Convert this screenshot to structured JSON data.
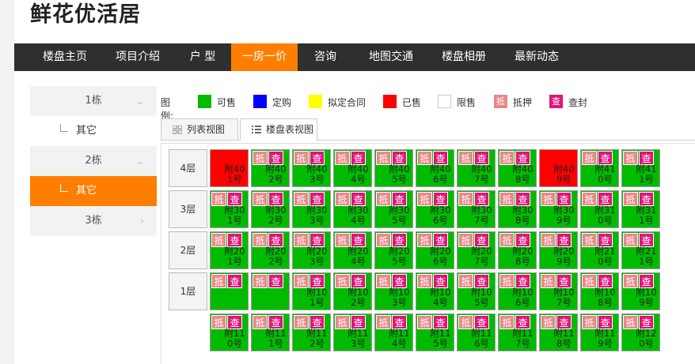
{
  "site": {
    "title": "鲜花优活居"
  },
  "nav": {
    "items": [
      "楼盘主页",
      "项目介绍",
      "户 型",
      "一房一价",
      "咨询",
      "地图交通",
      "楼盘相册",
      "最新动态"
    ],
    "active": "一房一价"
  },
  "sidebar": {
    "buildings": [
      {
        "label": "1栋",
        "arrow": "⌄",
        "sub": "其它",
        "sub_active": false
      },
      {
        "label": "2栋",
        "arrow": "⌄",
        "sub": "其它",
        "sub_active": true
      },
      {
        "label": "3栋",
        "arrow": "›"
      }
    ]
  },
  "legend": {
    "title": "图例:",
    "items": [
      {
        "label": "可售",
        "color": "#00bb00"
      },
      {
        "label": "定购",
        "color": "#0000ff"
      },
      {
        "label": "拟定合同",
        "color": "#ffff00"
      },
      {
        "label": "已售",
        "color": "#ff0000"
      },
      {
        "label": "限售",
        "color": "#ffffff"
      },
      {
        "label": "抵押",
        "badge": "抵",
        "color": "#e8888a"
      },
      {
        "label": "查封",
        "badge": "查",
        "color": "#e0147a"
      }
    ]
  },
  "tabs": {
    "list_view": "列表视图",
    "table_view": "楼盘表视图",
    "active": "楼盘表视图"
  },
  "badges": {
    "mortgage": "抵",
    "seized": "查"
  },
  "floors": [
    {
      "label": "4层",
      "units": [
        {
          "name": "附401号",
          "status": "sold",
          "badges": false
        },
        {
          "name": "附402号",
          "status": "avail",
          "badges": true
        },
        {
          "name": "附403号",
          "status": "avail",
          "badges": true
        },
        {
          "name": "附404号",
          "status": "avail",
          "badges": true
        },
        {
          "name": "附405号",
          "status": "avail",
          "badges": true
        },
        {
          "name": "附406号",
          "status": "avail",
          "badges": true
        },
        {
          "name": "附407号",
          "status": "avail",
          "badges": true
        },
        {
          "name": "附408号",
          "status": "avail",
          "badges": true
        },
        {
          "name": "附409号",
          "status": "sold",
          "badges": false
        },
        {
          "name": "附410号",
          "status": "avail",
          "badges": true
        },
        {
          "name": "附411号",
          "status": "avail",
          "badges": true
        }
      ]
    },
    {
      "label": "3层",
      "units": [
        {
          "name": "附301号",
          "status": "avail",
          "badges": true
        },
        {
          "name": "附302号",
          "status": "avail",
          "badges": true
        },
        {
          "name": "附303号",
          "status": "avail",
          "badges": true
        },
        {
          "name": "附304号",
          "status": "avail",
          "badges": true
        },
        {
          "name": "附305号",
          "status": "avail",
          "badges": true
        },
        {
          "name": "附306号",
          "status": "avail",
          "badges": true
        },
        {
          "name": "附307号",
          "status": "avail",
          "badges": true
        },
        {
          "name": "附308号",
          "status": "avail",
          "badges": true
        },
        {
          "name": "附309号",
          "status": "avail",
          "badges": true
        },
        {
          "name": "附310号",
          "status": "avail",
          "badges": true
        },
        {
          "name": "附311号",
          "status": "avail",
          "badges": true
        }
      ]
    },
    {
      "label": "2层",
      "units": [
        {
          "name": "附201号",
          "status": "avail",
          "badges": true
        },
        {
          "name": "附202号",
          "status": "avail",
          "badges": true
        },
        {
          "name": "附203号",
          "status": "avail",
          "badges": true
        },
        {
          "name": "附204号",
          "status": "avail",
          "badges": true
        },
        {
          "name": "附205号",
          "status": "avail",
          "badges": true
        },
        {
          "name": "附206号",
          "status": "avail",
          "badges": true
        },
        {
          "name": "附207号",
          "status": "avail",
          "badges": true
        },
        {
          "name": "附208号",
          "status": "avail",
          "badges": true
        },
        {
          "name": "附209号",
          "status": "avail",
          "badges": true
        },
        {
          "name": "附210号",
          "status": "avail",
          "badges": true
        },
        {
          "name": "附211号",
          "status": "avail",
          "badges": true
        }
      ]
    },
    {
      "label": "1层",
      "units": [
        {
          "name": "",
          "status": "avail",
          "badges": true
        },
        {
          "name": "",
          "status": "avail",
          "badges": true
        },
        {
          "name": "附101号",
          "status": "avail",
          "badges": true
        },
        {
          "name": "附102号",
          "status": "avail",
          "badges": true
        },
        {
          "name": "附103号",
          "status": "avail",
          "badges": true
        },
        {
          "name": "附104号",
          "status": "avail",
          "badges": true
        },
        {
          "name": "附105号",
          "status": "avail",
          "badges": true
        },
        {
          "name": "附106号",
          "status": "avail",
          "badges": true
        },
        {
          "name": "附107号",
          "status": "avail",
          "badges": true
        },
        {
          "name": "附108号",
          "status": "avail",
          "badges": true
        },
        {
          "name": "附109号",
          "status": "avail",
          "badges": true
        }
      ]
    },
    {
      "label": "",
      "units": [
        {
          "name": "附110号",
          "status": "avail",
          "badges": true
        },
        {
          "name": "附111号",
          "status": "avail",
          "badges": true
        },
        {
          "name": "附112号",
          "status": "avail",
          "badges": true
        },
        {
          "name": "附113号",
          "status": "avail",
          "badges": true
        },
        {
          "name": "附114号",
          "status": "avail",
          "badges": true
        },
        {
          "name": "附115号",
          "status": "avail",
          "badges": true
        },
        {
          "name": "附116号",
          "status": "avail",
          "badges": true
        },
        {
          "name": "附117号",
          "status": "avail",
          "badges": true
        },
        {
          "name": "附118号",
          "status": "avail",
          "badges": true
        },
        {
          "name": "附119号",
          "status": "avail",
          "badges": true
        },
        {
          "name": "附120号",
          "status": "avail",
          "badges": true
        }
      ]
    }
  ]
}
